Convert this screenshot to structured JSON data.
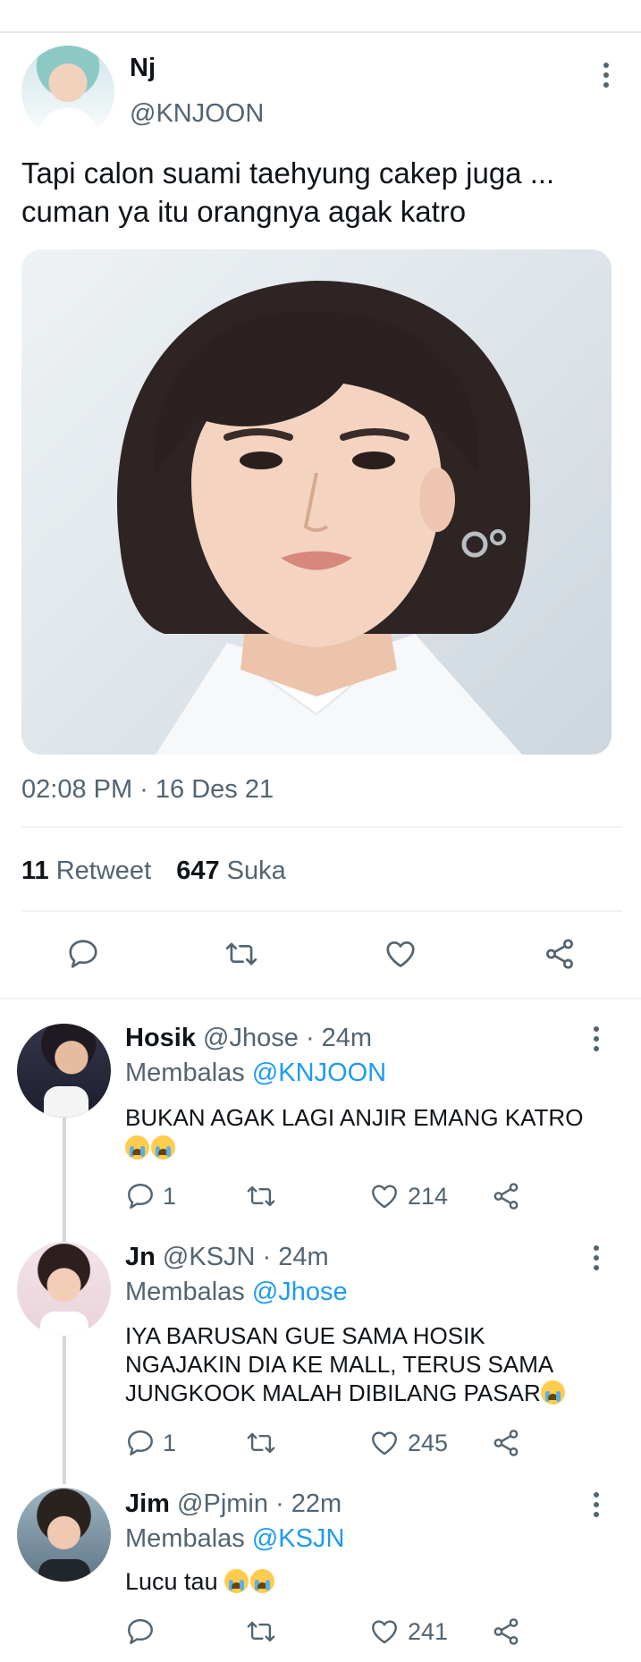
{
  "tweet": {
    "author_name": "Nj",
    "author_handle": "@KNJOON",
    "text_line1": "Tapi calon suami taehyung cakep juga ...",
    "text_line2": "cuman ya itu orangnya agak katro",
    "timestamp": "02:08 PM · 16 Des 21",
    "retweet_count": "11",
    "retweet_label": "Retweet",
    "like_count": "647",
    "like_label": "Suka"
  },
  "replies": [
    {
      "name": "Hosik",
      "handle": "@Jhose",
      "time": "· 24m",
      "replying_prefix": "Membalas",
      "replying_to": "@KNJOON",
      "text_line1": "BUKAN AGAK LAGI ANJIR EMANG KATRO",
      "text_line2": "",
      "text_line3": "",
      "reply_count": "1",
      "like_count": "214"
    },
    {
      "name": "Jn",
      "handle": "@KSJN",
      "time": "· 24m",
      "replying_prefix": "Membalas",
      "replying_to": "@Jhose",
      "text_line1": "IYA BARUSAN GUE SAMA HOSIK",
      "text_line2": "NGAJAKIN DIA KE MALL, TERUS SAMA",
      "text_line3": "JUNGKOOK MALAH DIBILANG PASAR",
      "reply_count": "1",
      "like_count": "245"
    },
    {
      "name": "Jim",
      "handle": "@Pjmin",
      "time": "· 22m",
      "replying_prefix": "Membalas",
      "replying_to": "@KSJN",
      "text_line1": "Lucu tau",
      "text_line2": "",
      "text_line3": "",
      "reply_count": "",
      "like_count": "241"
    }
  ],
  "icons": {
    "reply": "reply-icon",
    "retweet": "retweet-icon",
    "like": "heart-icon",
    "share": "share-icon",
    "more": "more-vertical-icon",
    "emoji": "loudly-crying-face-emoji"
  },
  "colors": {
    "link": "#1d9bf0",
    "secondary_text": "#536471",
    "primary_text": "#0f1419"
  }
}
